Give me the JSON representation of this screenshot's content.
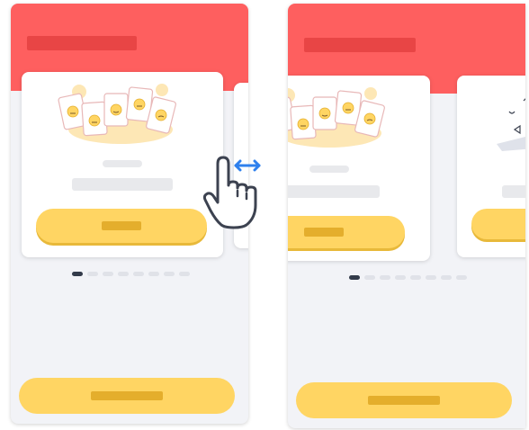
{
  "colors": {
    "header": "#fe5f5f",
    "header_title": "#e84545",
    "background": "#f2f3f7",
    "card": "#ffffff",
    "placeholder": "#e8e9ec",
    "button": "#ffd563",
    "button_shadow": "#e8b93a",
    "button_label": "#e4ae2c",
    "dot_active": "#333b4a",
    "dot_inactive": "#e0e2e8",
    "arrow": "#2f80ed",
    "hand_outline": "#3c4250"
  },
  "screens": [
    {
      "id": "left",
      "active_dot": 0,
      "dot_count": 8
    },
    {
      "id": "right",
      "active_dot": 0,
      "dot_count": 8
    }
  ],
  "icons": [
    "hand-pointer-icon",
    "double-arrow-icon",
    "emoji-cards-illustration",
    "tilted-card-illustration"
  ]
}
